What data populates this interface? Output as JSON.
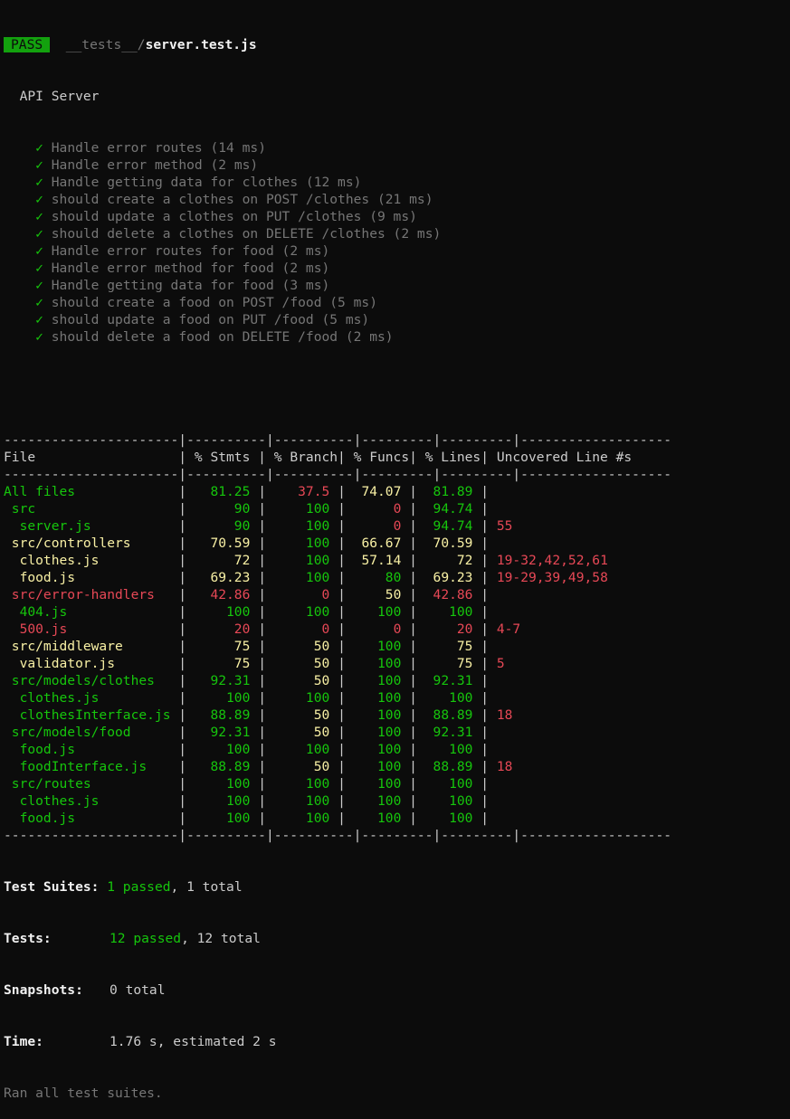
{
  "header": {
    "status": "PASS",
    "path_dir": "__tests__/",
    "path_file": "server.test.js",
    "suite_name": "API Server"
  },
  "tests": [
    {
      "check": "✓",
      "text": "Handle error routes (14 ms)"
    },
    {
      "check": "✓",
      "text": "Handle error method (2 ms)"
    },
    {
      "check": "✓",
      "text": "Handle getting data for clothes (12 ms)"
    },
    {
      "check": "✓",
      "text": "should create a clothes on POST /clothes (21 ms)"
    },
    {
      "check": "✓",
      "text": "should update a clothes on PUT /clothes (9 ms)"
    },
    {
      "check": "✓",
      "text": "should delete a clothes on DELETE /clothes (2 ms)"
    },
    {
      "check": "✓",
      "text": "Handle error routes for food (2 ms)"
    },
    {
      "check": "✓",
      "text": "Handle error method for food (2 ms)"
    },
    {
      "check": "✓",
      "text": "Handle getting data for food (3 ms)"
    },
    {
      "check": "✓",
      "text": "should create a food on POST /food (5 ms)"
    },
    {
      "check": "✓",
      "text": "should update a food on PUT /food (5 ms)"
    },
    {
      "check": "✓",
      "text": "should delete a food on DELETE /food (2 ms)"
    }
  ],
  "coverage": {
    "separator": "----------------------|----------|----------|---------|---------|-------------------",
    "headers": [
      "File",
      "% Stmts",
      "% Branch",
      "% Funcs",
      "% Lines",
      "Uncovered Line #s"
    ],
    "rows": [
      {
        "file": "All files",
        "indent": 0,
        "stmts": "81.25",
        "branch": "37.5",
        "funcs": "74.07",
        "lines": "81.89",
        "uncovered": "",
        "c": [
          "g",
          "g",
          "r",
          "y",
          "g"
        ]
      },
      {
        "file": "src",
        "indent": 1,
        "stmts": "90",
        "branch": "100",
        "funcs": "0",
        "lines": "94.74",
        "uncovered": "",
        "c": [
          "g",
          "g",
          "g",
          "r",
          "g"
        ]
      },
      {
        "file": "server.js",
        "indent": 2,
        "stmts": "90",
        "branch": "100",
        "funcs": "0",
        "lines": "94.74",
        "uncovered": "55",
        "c": [
          "g",
          "g",
          "g",
          "r",
          "g"
        ]
      },
      {
        "file": "src/controllers",
        "indent": 1,
        "stmts": "70.59",
        "branch": "100",
        "funcs": "66.67",
        "lines": "70.59",
        "uncovered": "",
        "c": [
          "y",
          "y",
          "g",
          "y",
          "y"
        ]
      },
      {
        "file": "clothes.js",
        "indent": 2,
        "stmts": "72",
        "branch": "100",
        "funcs": "57.14",
        "lines": "72",
        "uncovered": "19-32,42,52,61",
        "c": [
          "y",
          "y",
          "g",
          "y",
          "y"
        ]
      },
      {
        "file": "food.js",
        "indent": 2,
        "stmts": "69.23",
        "branch": "100",
        "funcs": "80",
        "lines": "69.23",
        "uncovered": "19-29,39,49,58",
        "c": [
          "y",
          "y",
          "g",
          "g",
          "y"
        ]
      },
      {
        "file": "src/error-handlers",
        "indent": 1,
        "stmts": "42.86",
        "branch": "0",
        "funcs": "50",
        "lines": "42.86",
        "uncovered": "",
        "c": [
          "r",
          "r",
          "r",
          "y",
          "r"
        ]
      },
      {
        "file": "404.js",
        "indent": 2,
        "stmts": "100",
        "branch": "100",
        "funcs": "100",
        "lines": "100",
        "uncovered": "",
        "c": [
          "g",
          "g",
          "g",
          "g",
          "g"
        ]
      },
      {
        "file": "500.js",
        "indent": 2,
        "stmts": "20",
        "branch": "0",
        "funcs": "0",
        "lines": "20",
        "uncovered": "4-7",
        "c": [
          "r",
          "r",
          "r",
          "r",
          "r"
        ]
      },
      {
        "file": "src/middleware",
        "indent": 1,
        "stmts": "75",
        "branch": "50",
        "funcs": "100",
        "lines": "75",
        "uncovered": "",
        "c": [
          "y",
          "y",
          "y",
          "g",
          "y"
        ]
      },
      {
        "file": "validator.js",
        "indent": 2,
        "stmts": "75",
        "branch": "50",
        "funcs": "100",
        "lines": "75",
        "uncovered": "5",
        "c": [
          "y",
          "y",
          "y",
          "g",
          "y"
        ]
      },
      {
        "file": "src/models/clothes",
        "indent": 1,
        "stmts": "92.31",
        "branch": "50",
        "funcs": "100",
        "lines": "92.31",
        "uncovered": "",
        "c": [
          "g",
          "g",
          "y",
          "g",
          "g"
        ]
      },
      {
        "file": "clothes.js",
        "indent": 2,
        "stmts": "100",
        "branch": "100",
        "funcs": "100",
        "lines": "100",
        "uncovered": "",
        "c": [
          "g",
          "g",
          "g",
          "g",
          "g"
        ]
      },
      {
        "file": "clothesInterface.js",
        "indent": 2,
        "stmts": "88.89",
        "branch": "50",
        "funcs": "100",
        "lines": "88.89",
        "uncovered": "18",
        "c": [
          "g",
          "g",
          "y",
          "g",
          "g"
        ]
      },
      {
        "file": "src/models/food",
        "indent": 1,
        "stmts": "92.31",
        "branch": "50",
        "funcs": "100",
        "lines": "92.31",
        "uncovered": "",
        "c": [
          "g",
          "g",
          "y",
          "g",
          "g"
        ]
      },
      {
        "file": "food.js",
        "indent": 2,
        "stmts": "100",
        "branch": "100",
        "funcs": "100",
        "lines": "100",
        "uncovered": "",
        "c": [
          "g",
          "g",
          "g",
          "g",
          "g"
        ]
      },
      {
        "file": "foodInterface.js",
        "indent": 2,
        "stmts": "88.89",
        "branch": "50",
        "funcs": "100",
        "lines": "88.89",
        "uncovered": "18",
        "c": [
          "g",
          "g",
          "y",
          "g",
          "g"
        ]
      },
      {
        "file": "src/routes",
        "indent": 1,
        "stmts": "100",
        "branch": "100",
        "funcs": "100",
        "lines": "100",
        "uncovered": "",
        "c": [
          "g",
          "g",
          "g",
          "g",
          "g"
        ]
      },
      {
        "file": "clothes.js",
        "indent": 2,
        "stmts": "100",
        "branch": "100",
        "funcs": "100",
        "lines": "100",
        "uncovered": "",
        "c": [
          "g",
          "g",
          "g",
          "g",
          "g"
        ]
      },
      {
        "file": "food.js",
        "indent": 2,
        "stmts": "100",
        "branch": "100",
        "funcs": "100",
        "lines": "100",
        "uncovered": "",
        "c": [
          "g",
          "g",
          "g",
          "g",
          "g"
        ]
      }
    ]
  },
  "summary": {
    "suites_label": "Test Suites:",
    "suites_passed": "1 passed",
    "suites_rest": ", 1 total",
    "tests_label": "Tests:",
    "tests_passed": "12 passed",
    "tests_rest": ", 12 total",
    "snapshots_label": "Snapshots:",
    "snapshots_value": "0 total",
    "time_label": "Time:",
    "time_value": "1.76 s, estimated 2 s",
    "ran_all": "Ran all test suites."
  },
  "colors": {
    "background": "#0c0c0c",
    "green": "#16c60c",
    "yellow": "#f9f1a5",
    "red": "#e74856",
    "text": "#cccccc",
    "dim": "#767676"
  }
}
